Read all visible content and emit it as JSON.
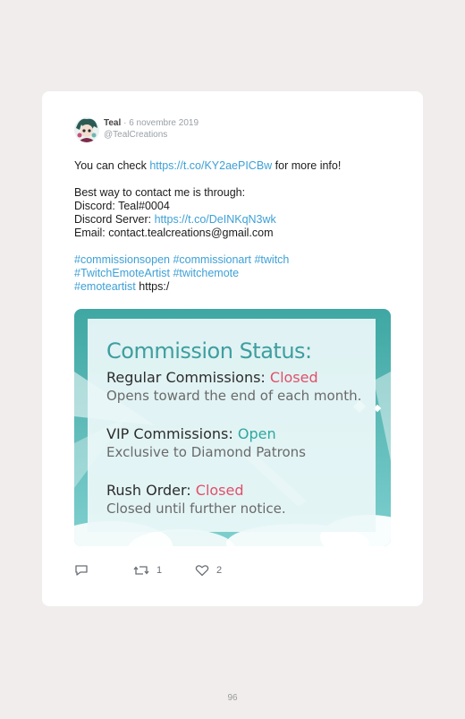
{
  "tweet": {
    "author_name": "Teal",
    "separator": "·",
    "date": "6 novembre 2019",
    "handle": "@TealCreations",
    "line1_pre": "You can check ",
    "line1_link": "https://t.co/KY2aePICBw",
    "line1_post": " for more info!",
    "line2": "Best way to contact me is through:",
    "line3": "Discord: Teal#0004",
    "line4_pre": "Discord Server: ",
    "line4_link": "https://t.co/DeINKqN3wk",
    "line5": "Email: contact.tealcreations@gmail.com",
    "hashtags_line1": "#commissionsopen #commissionart #twitch",
    "hashtags_line2": "#TwitchEmoteArtist #twitchemote",
    "hashtags_line3": "#emoteartist",
    "trailing_url": "https:/"
  },
  "media": {
    "title": "Commission Status:",
    "regular_label": "Regular Commissions: ",
    "regular_status": "Closed",
    "regular_note": "Opens toward the end of each month.",
    "vip_label": "VIP Commissions: ",
    "vip_status": "Open",
    "vip_note": "Exclusive to Diamond Patrons",
    "rush_label": "Rush Order: ",
    "rush_status": "Closed",
    "rush_note": "Closed until further notice."
  },
  "actions": {
    "reply_icon": "reply-icon",
    "retweet_icon": "retweet-icon",
    "retweet_count": "1",
    "like_icon": "heart-icon",
    "like_count": "2"
  },
  "page": {
    "number": "96"
  },
  "colors": {
    "link": "#3da0d6",
    "closed": "#e0506a",
    "open": "#2ea7a0",
    "teal_title": "#3e9e9f",
    "page_bg": "#f1eded"
  }
}
